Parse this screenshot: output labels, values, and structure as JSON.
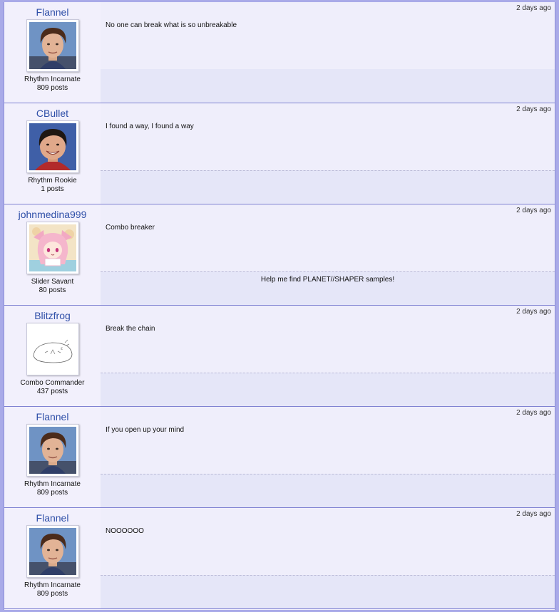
{
  "posts": [
    {
      "username": "Flannel",
      "rank": "Rhythm Incarnate",
      "post_count": "809 posts",
      "avatar": "flannel-avatar",
      "timestamp": "2 days ago",
      "message": "No one can break what is so unbreakable",
      "signature": ""
    },
    {
      "username": "CBullet",
      "rank": "Rhythm Rookie",
      "post_count": "1 posts",
      "avatar": "cbullet-avatar",
      "timestamp": "2 days ago",
      "message": "I found a way, I found a way",
      "signature": ""
    },
    {
      "username": "johnmedina999",
      "rank": "Slider Savant",
      "post_count": "80 posts",
      "avatar": "anime-girl-avatar",
      "timestamp": "2 days ago",
      "message": "Combo breaker",
      "signature": "Help me find PLANET//SHAPER samples!"
    },
    {
      "username": "Blitzfrog",
      "rank": "Combo Commander",
      "post_count": "437 posts",
      "avatar": "sketch-avatar",
      "timestamp": "2 days ago",
      "message": "Break the chain",
      "signature": ""
    },
    {
      "username": "Flannel",
      "rank": "Rhythm Incarnate",
      "post_count": "809 posts",
      "avatar": "flannel-avatar",
      "timestamp": "2 days ago",
      "message": "If you open up your mind",
      "signature": ""
    },
    {
      "username": "Flannel",
      "rank": "Rhythm Incarnate",
      "post_count": "809 posts",
      "avatar": "flannel-avatar",
      "timestamp": "2 days ago",
      "message": "NOOOOOO",
      "signature": ""
    }
  ],
  "colors": {
    "username": "#2f4fa8",
    "background": "#a9aae8",
    "post_bg": "#f2f0fc",
    "signature_bg": "#e5e6f8",
    "border": "#7f82d2"
  }
}
